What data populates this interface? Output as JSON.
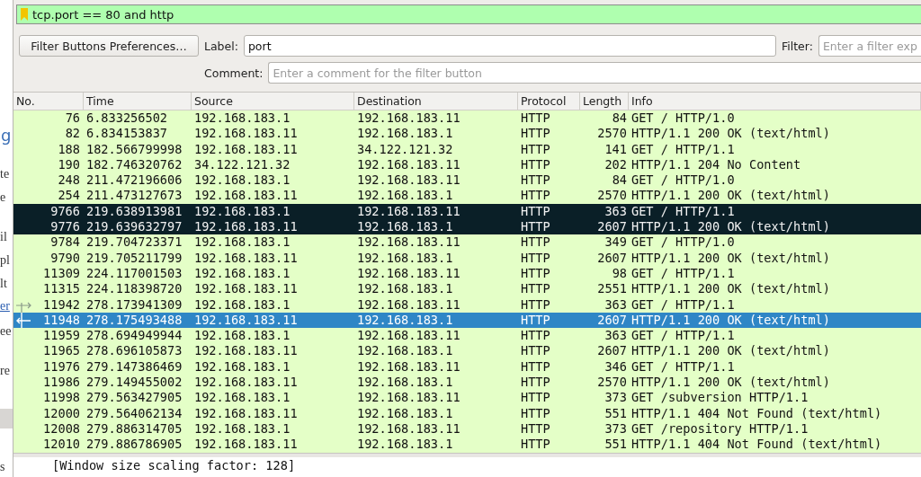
{
  "display_filter": {
    "value": "tcp.port == 80 and http"
  },
  "background_window": {
    "fragments": [
      {
        "text": "g",
        "kind": "heading"
      },
      {
        "text": "te",
        "kind": "text"
      },
      {
        "text": "e",
        "kind": "text"
      },
      {
        "text": "il",
        "kind": "text"
      },
      {
        "text": "pl",
        "kind": "text"
      },
      {
        "text": "lt",
        "kind": "text"
      },
      {
        "text": "er",
        "kind": "link"
      },
      {
        "text": "ee",
        "kind": "text"
      },
      {
        "text": "re",
        "kind": "text"
      },
      {
        "text": "s",
        "kind": "text"
      }
    ]
  },
  "filter_button_toolbar": {
    "button": "Filter Buttons Preferences…",
    "label_caption": "Label:",
    "label_value": "port",
    "filter_caption": "Filter:",
    "filter_placeholder": "Enter a filter exp",
    "comment_caption": "Comment:",
    "comment_placeholder": "Enter a comment for the filter button"
  },
  "packet_list": {
    "columns": [
      "No.",
      "Time",
      "Source",
      "Destination",
      "Protocol",
      "Length",
      "Info"
    ],
    "rows": [
      {
        "kind": "plain",
        "cells": [
          "76",
          "6.833256502",
          "192.168.183.1",
          "192.168.183.11",
          "HTTP",
          "84",
          "GET / HTTP/1.0"
        ],
        "selected": false,
        "marked": false
      },
      {
        "kind": "plain",
        "cells": [
          "82",
          "6.834153837",
          "192.168.183.11",
          "192.168.183.1",
          "HTTP",
          "2570",
          "HTTP/1.1 200 OK  (text/html)"
        ],
        "selected": false,
        "marked": false
      },
      {
        "kind": "plain",
        "cells": [
          "188",
          "182.566799998",
          "192.168.183.11",
          "34.122.121.32",
          "HTTP",
          "141",
          "GET / HTTP/1.1"
        ],
        "selected": false,
        "marked": false
      },
      {
        "kind": "plain",
        "cells": [
          "190",
          "182.746320762",
          "34.122.121.32",
          "192.168.183.11",
          "HTTP",
          "202",
          "HTTP/1.1 204 No Content"
        ],
        "selected": false,
        "marked": false
      },
      {
        "kind": "plain",
        "cells": [
          "248",
          "211.472196606",
          "192.168.183.1",
          "192.168.183.11",
          "HTTP",
          "84",
          "GET / HTTP/1.0"
        ],
        "selected": false,
        "marked": false
      },
      {
        "kind": "plain",
        "cells": [
          "254",
          "211.473127673",
          "192.168.183.11",
          "192.168.183.1",
          "HTTP",
          "2570",
          "HTTP/1.1 200 OK  (text/html)"
        ],
        "selected": false,
        "marked": false
      },
      {
        "kind": "plain",
        "cells": [
          "9766",
          "219.638913981",
          "192.168.183.1",
          "192.168.183.11",
          "HTTP",
          "363",
          "GET / HTTP/1.1"
        ],
        "selected": false,
        "marked": true
      },
      {
        "kind": "plain",
        "cells": [
          "9776",
          "219.639632797",
          "192.168.183.11",
          "192.168.183.1",
          "HTTP",
          "2607",
          "HTTP/1.1 200 OK  (text/html)"
        ],
        "selected": false,
        "marked": true
      },
      {
        "kind": "plain",
        "cells": [
          "9784",
          "219.704723371",
          "192.168.183.1",
          "192.168.183.11",
          "HTTP",
          "349",
          "GET / HTTP/1.0"
        ],
        "selected": false,
        "marked": false
      },
      {
        "kind": "plain",
        "cells": [
          "9790",
          "219.705211799",
          "192.168.183.11",
          "192.168.183.1",
          "HTTP",
          "2607",
          "HTTP/1.1 200 OK  (text/html)"
        ],
        "selected": false,
        "marked": false
      },
      {
        "kind": "plain",
        "cells": [
          "11309",
          "224.117001503",
          "192.168.183.1",
          "192.168.183.11",
          "HTTP",
          "98",
          "GET / HTTP/1.1"
        ],
        "selected": false,
        "marked": false
      },
      {
        "kind": "plain",
        "cells": [
          "11315",
          "224.118398720",
          "192.168.183.11",
          "192.168.183.1",
          "HTTP",
          "2551",
          "HTTP/1.1 200 OK  (text/html)"
        ],
        "selected": false,
        "marked": false
      },
      {
        "kind": "request",
        "cells": [
          "11942",
          "278.173941309",
          "192.168.183.1",
          "192.168.183.11",
          "HTTP",
          "363",
          "GET / HTTP/1.1"
        ],
        "selected": false,
        "marked": false
      },
      {
        "kind": "response",
        "cells": [
          "11948",
          "278.175493488",
          "192.168.183.11",
          "192.168.183.1",
          "HTTP",
          "2607",
          "HTTP/1.1 200 OK  (text/html)"
        ],
        "selected": true,
        "marked": false
      },
      {
        "kind": "plain",
        "cells": [
          "11959",
          "278.694949944",
          "192.168.183.1",
          "192.168.183.11",
          "HTTP",
          "363",
          "GET / HTTP/1.1"
        ],
        "selected": false,
        "marked": false
      },
      {
        "kind": "plain",
        "cells": [
          "11965",
          "278.696105873",
          "192.168.183.11",
          "192.168.183.1",
          "HTTP",
          "2607",
          "HTTP/1.1 200 OK  (text/html)"
        ],
        "selected": false,
        "marked": false
      },
      {
        "kind": "plain",
        "cells": [
          "11976",
          "279.147386469",
          "192.168.183.1",
          "192.168.183.11",
          "HTTP",
          "346",
          "GET / HTTP/1.1"
        ],
        "selected": false,
        "marked": false
      },
      {
        "kind": "plain",
        "cells": [
          "11986",
          "279.149455002",
          "192.168.183.11",
          "192.168.183.1",
          "HTTP",
          "2570",
          "HTTP/1.1 200 OK  (text/html)"
        ],
        "selected": false,
        "marked": false
      },
      {
        "kind": "plain",
        "cells": [
          "11998",
          "279.563427905",
          "192.168.183.1",
          "192.168.183.11",
          "HTTP",
          "373",
          "GET /subversion HTTP/1.1"
        ],
        "selected": false,
        "marked": false
      },
      {
        "kind": "plain",
        "cells": [
          "12000",
          "279.564062134",
          "192.168.183.11",
          "192.168.183.1",
          "HTTP",
          "551",
          "HTTP/1.1 404 Not Found  (text/html)"
        ],
        "selected": false,
        "marked": false
      },
      {
        "kind": "plain",
        "cells": [
          "12008",
          "279.886314705",
          "192.168.183.1",
          "192.168.183.11",
          "HTTP",
          "373",
          "GET /repository HTTP/1.1"
        ],
        "selected": false,
        "marked": false
      },
      {
        "kind": "plain",
        "cells": [
          "12010",
          "279.886786905",
          "192.168.183.11",
          "192.168.183.1",
          "HTTP",
          "551",
          "HTTP/1.1 404 Not Found  (text/html)"
        ],
        "selected": false,
        "marked": false
      }
    ]
  },
  "packet_details": {
    "lines": [
      "[Window size scaling factor: 128]"
    ]
  }
}
